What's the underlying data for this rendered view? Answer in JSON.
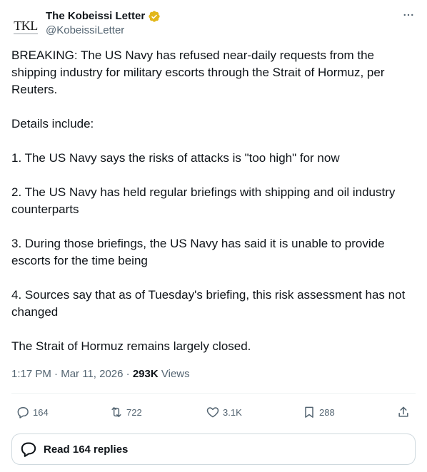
{
  "author": {
    "display_name": "The Kobeissi Letter",
    "handle": "@KobeissiLetter",
    "avatar_text": "TKL",
    "verified_color": "#e2b719"
  },
  "tweet": {
    "paragraphs": [
      "BREAKING: The US Navy has refused near-daily requests from the shipping industry for military escorts through the Strait of Hormuz, per Reuters.",
      "Details include:",
      "1. The US Navy says the risks of attacks is \"too high\" for now",
      "2. The US Navy has held regular briefings with shipping and oil industry counterparts",
      "3. During those briefings, the US Navy has said it is unable to provide escorts for the time being",
      "4. Sources say that as of Tuesday's briefing, this risk assessment has not changed",
      "The Strait of Hormuz remains largely closed."
    ],
    "time": "1:17 PM",
    "date": "Mar 11, 2026",
    "separator": "·",
    "views_count": "293K",
    "views_label": "Views"
  },
  "actions": {
    "replies": "164",
    "reposts": "722",
    "likes": "3.1K",
    "bookmarks": "288"
  },
  "replies_button": {
    "label": "Read 164 replies"
  },
  "colors": {
    "text_primary": "#0f1419",
    "text_secondary": "#536471",
    "border": "#cfd9de",
    "divider": "#eff3f4"
  }
}
